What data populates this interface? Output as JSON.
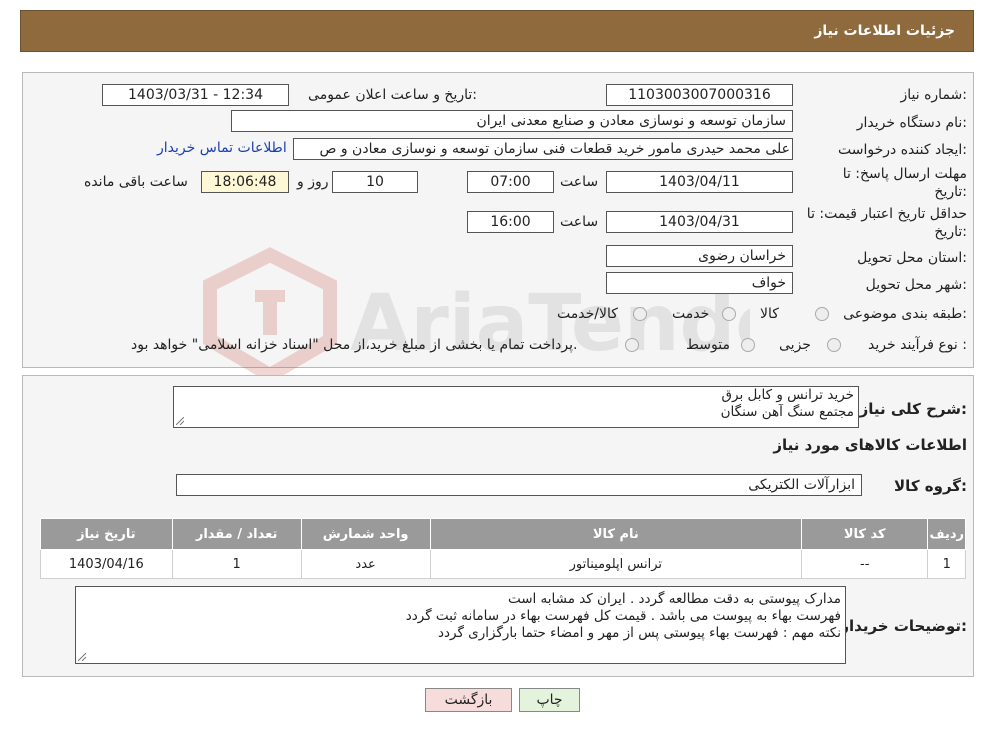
{
  "header": {
    "title": "جزئیات اطلاعات نیاز"
  },
  "form": {
    "need_number_label": "شماره نیاز:",
    "need_number": "1103003007000316",
    "announce_label": "تاریخ و ساعت اعلان عمومی:",
    "announce_value": "1403/03/31 - 12:34",
    "buyer_org_label": "نام دستگاه خریدار:",
    "buyer_org": "سازمان توسعه و نوسازی معادن و صنایع معدنی ایران",
    "requester_label": "ایجاد کننده درخواست:",
    "requester": "علی محمد حیدری مامور خرید قطعات فنی سازمان توسعه و نوسازی معادن و ص",
    "contact_link": "اطلاعات تماس خریدار",
    "deadline_label_1": "مهلت ارسال پاسخ: تا",
    "deadline_label_2": "تاریخ:",
    "deadline_date": "1403/04/11",
    "time_label": "ساعت",
    "deadline_time": "07:00",
    "days_value": "10",
    "days_label": "روز و",
    "remaining_time": "18:06:48",
    "remaining_label": "ساعت باقی مانده",
    "validity_label_1": "حداقل تاریخ اعتبار قیمت: تا",
    "validity_label_2": "تاریخ:",
    "validity_date": "1403/04/31",
    "validity_time": "16:00",
    "province_label": "استان محل تحویل:",
    "province": "خراسان رضوی",
    "city_label": "شهر محل تحویل:",
    "city": "خواف",
    "category_label": "طبقه بندی موضوعی:",
    "category_options": [
      "کالا",
      "خدمت",
      "کالا/خدمت"
    ],
    "process_label": "نوع فرآیند خرید :",
    "process_options": [
      "جزیی",
      "متوسط"
    ],
    "process_note": "پرداخت تمام یا بخشی از مبلغ خرید،از محل \"اسناد خزانه اسلامی\" خواهد بود."
  },
  "summary": {
    "label": "شرح کلی نیاز:",
    "lines": [
      "خرید ترانس و کابل برق",
      "مجتمع سنگ آهن سنگان"
    ]
  },
  "goods": {
    "section_title": "اطلاعات کالاهای مورد نیاز",
    "group_label": "گروه کالا:",
    "group_value": "ابزارآلات الکتریکی",
    "columns": [
      "ردیف",
      "کد کالا",
      "نام کالا",
      "واحد شمارش",
      "تعداد / مقدار",
      "تاریخ نیاز"
    ],
    "rows": [
      [
        "1",
        "--",
        "ترانس اپلومیناتور",
        "عدد",
        "1",
        "1403/04/16"
      ]
    ]
  },
  "notes": {
    "label": "توضیحات خریدار:",
    "lines": [
      "مدارک پیوستی به دقت مطالعه گردد . ایران کد مشابه است",
      "فهرست بهاء به پیوست می باشد . قیمت کل فهرست بهاء در سامانه ثبت گردد",
      "نکته مهم : فهرست بهاء پیوستی پس از مهر و امضاء حتما بارگزاری گردد"
    ]
  },
  "buttons": {
    "print": "چاپ",
    "back": "بازگشت"
  },
  "watermark": {
    "text": "AriaTender.neT"
  },
  "colors": {
    "header_bg": "#8e6a3c",
    "table_header": "#9a9a9a",
    "link": "#1a3fb5",
    "back_button_bg": "#f7dcdc",
    "print_button_bg": "#e4f4dc",
    "highlight_bg": "#fff8d6"
  }
}
